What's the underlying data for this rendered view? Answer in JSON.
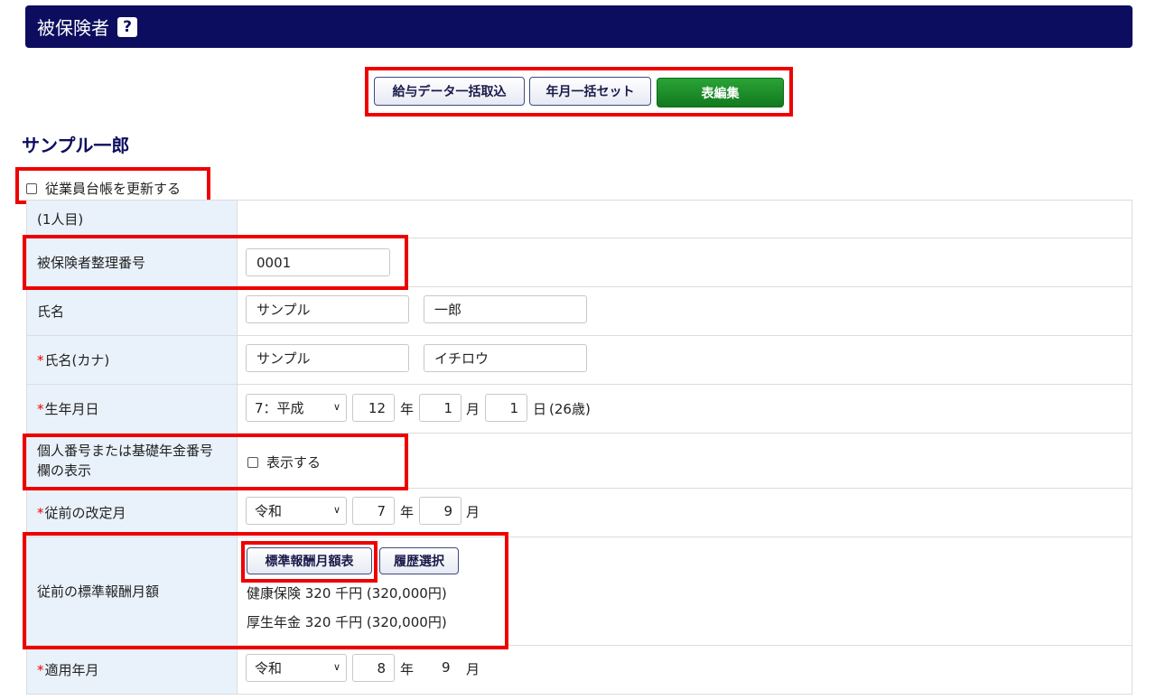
{
  "header": {
    "title": "被保険者",
    "help": "?"
  },
  "toolbar": {
    "import_label": "給与データ一括取込",
    "setdate_label": "年月一括セット",
    "edit_label": "表編集"
  },
  "person": {
    "name": "サンプル一郎"
  },
  "update_ledger": {
    "label": "従業員台帳を更新する"
  },
  "form": {
    "row1": {
      "label": "(1人目)"
    },
    "insured_no": {
      "label": "被保険者整理番号",
      "value": "0001"
    },
    "name": {
      "label": "氏名",
      "last": "サンプル",
      "first": "一郎"
    },
    "kana": {
      "required": "*",
      "label": "氏名(カナ)",
      "last": "サンプル",
      "first": "イチロウ"
    },
    "birth": {
      "required": "*",
      "label": "生年月日",
      "era": "7：平成",
      "year": "12",
      "year_unit": "年",
      "month": "1",
      "month_unit": "月",
      "day": "1",
      "day_unit": "日",
      "age": "(26歳)"
    },
    "mynumber": {
      "label_line1": "個人番号または基礎年金番号",
      "label_line2": "欄の表示",
      "checkbox_label": "表示する"
    },
    "prev_revision": {
      "required": "*",
      "label": "従前の改定月",
      "era": "令和",
      "year": "7",
      "year_unit": "年",
      "month": "9",
      "month_unit": "月"
    },
    "prev_salary": {
      "label": "従前の標準報酬月額",
      "table_button": "標準報酬月額表",
      "history_button": "履歴選択",
      "health": "健康保険 320 千円 (320,000円)",
      "pension": "厚生年金 320 千円 (320,000円)"
    },
    "applicable": {
      "required": "*",
      "label": "適用年月",
      "era": "令和",
      "year": "8",
      "year_unit": "年",
      "month": "9",
      "month_unit": "月"
    }
  }
}
